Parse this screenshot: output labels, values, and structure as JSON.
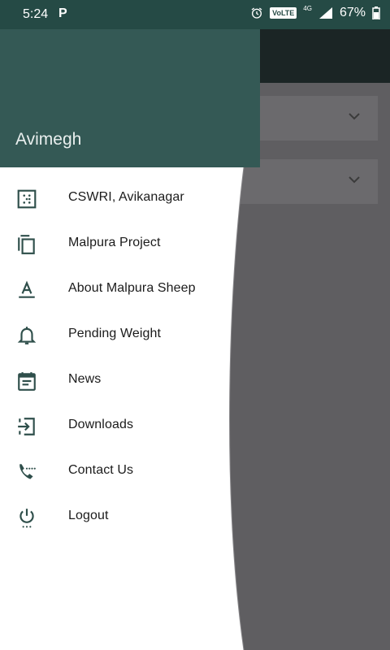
{
  "status_bar": {
    "time": "5:24",
    "app_indicator": "P",
    "volte": "VoLTE",
    "network": "4G",
    "battery": "67%"
  },
  "drawer": {
    "user_name": "Avimegh",
    "items": [
      {
        "label": "CSWRI, Avikanagar",
        "icon": "grid-dots-icon"
      },
      {
        "label": "Malpura Project",
        "icon": "copy-icon"
      },
      {
        "label": "About Malpura Sheep",
        "icon": "text-format-icon"
      },
      {
        "label": "Pending Weight",
        "icon": "bell-icon"
      },
      {
        "label": "News",
        "icon": "calendar-note-icon"
      },
      {
        "label": "Downloads",
        "icon": "login-icon"
      },
      {
        "label": "Contact Us",
        "icon": "phone-dialing-icon"
      },
      {
        "label": "Logout",
        "icon": "power-icon"
      }
    ]
  },
  "colors": {
    "header": "#345955",
    "status_bar": "#254a45",
    "icon": "#2f4f4b",
    "scrim": "#5f5e61"
  }
}
